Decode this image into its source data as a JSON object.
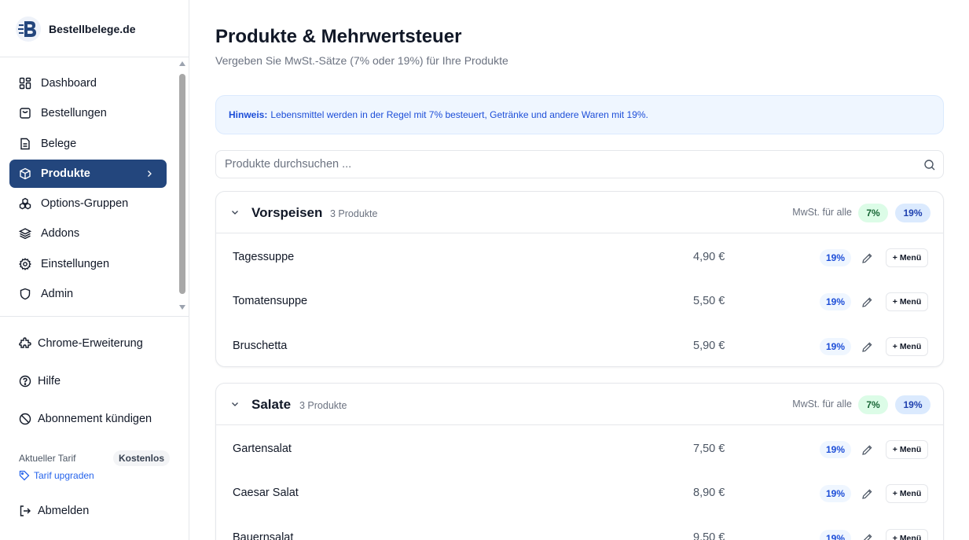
{
  "brand": {
    "name": "Bestellbelege.de"
  },
  "sidebar": {
    "items": [
      {
        "label": "Dashboard",
        "icon": "dashboard-icon"
      },
      {
        "label": "Bestellungen",
        "icon": "shopping-bag-icon"
      },
      {
        "label": "Belege",
        "icon": "document-icon"
      },
      {
        "label": "Produkte",
        "icon": "package-icon",
        "active": true
      },
      {
        "label": "Options-Gruppen",
        "icon": "options-group-icon"
      },
      {
        "label": "Addons",
        "icon": "layers-icon"
      },
      {
        "label": "Einstellungen",
        "icon": "gear-icon"
      },
      {
        "label": "Admin",
        "icon": "shield-icon"
      }
    ],
    "bottom": {
      "chrome": "Chrome-Erweiterung",
      "help": "Hilfe",
      "cancel": "Abonnement kündigen",
      "plan_label": "Aktueller Tarif",
      "plan_value": "Kostenlos",
      "upgrade": "Tarif upgraden",
      "logout": "Abmelden"
    }
  },
  "page": {
    "title": "Produkte & Mehrwertsteuer",
    "subtitle": "Vergeben Sie MwSt.-Sätze (7% oder 19%) für Ihre Produkte",
    "hint_label": "Hinweis:",
    "hint_text": "Lebensmittel werden in der Regel mit 7% besteuert, Getränke und andere Waren mit 19%.",
    "search_placeholder": "Produkte durchsuchen ..."
  },
  "categories": [
    {
      "name": "Vorspeisen",
      "count": "3 Produkte",
      "all_label": "MwSt. für alle",
      "rate_a": "7%",
      "rate_b": "19%",
      "products": [
        {
          "name": "Tagessuppe",
          "price": "4,90 €",
          "vat": "19%",
          "menu": "+ Menü"
        },
        {
          "name": "Tomatensuppe",
          "price": "5,50 €",
          "vat": "19%",
          "menu": "+ Menü"
        },
        {
          "name": "Bruschetta",
          "price": "5,90 €",
          "vat": "19%",
          "menu": "+ Menü"
        }
      ]
    },
    {
      "name": "Salate",
      "count": "3 Produkte",
      "all_label": "MwSt. für alle",
      "rate_a": "7%",
      "rate_b": "19%",
      "products": [
        {
          "name": "Gartensalat",
          "price": "7,50 €",
          "vat": "19%",
          "menu": "+ Menü"
        },
        {
          "name": "Caesar Salat",
          "price": "8,90 €",
          "vat": "19%",
          "menu": "+ Menü"
        },
        {
          "name": "Bauernsalat",
          "price": "9,50 €",
          "vat": "19%",
          "menu": "+ Menü"
        }
      ]
    }
  ],
  "colors": {
    "accent": "#23467d",
    "hint_bg": "#eff6ff",
    "hint_text": "#1d4ed8",
    "rate7_bg": "#dcfce7",
    "rate19_bg": "#dbeafe"
  }
}
